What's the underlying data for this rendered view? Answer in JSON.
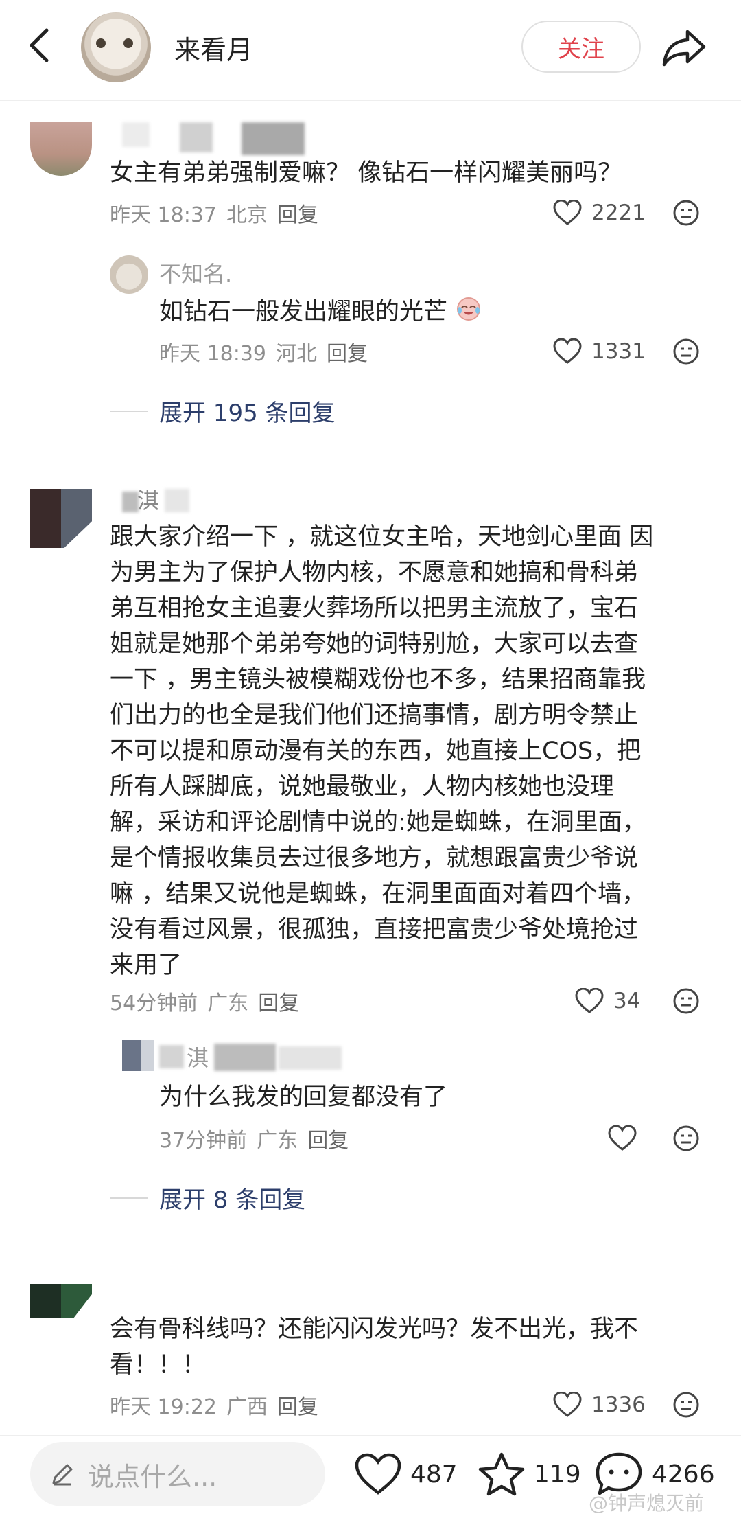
{
  "header": {
    "user_name": "来看月",
    "follow_label": "关注",
    "back_icon": "chevron-left-icon",
    "share_icon": "share-icon"
  },
  "comments": [
    {
      "text": "女主有弟弟强制爱嘛？ 像钻石一样闪耀美丽吗？",
      "time": "昨天 18:37",
      "location": "北京",
      "reply_label": "回复",
      "likes": "2221",
      "reply": {
        "user": "不知名.",
        "text": "如钻石一般发出耀眼的光芒",
        "emoji": "crying-laughing-emoji",
        "time": "昨天 18:39",
        "location": "河北",
        "reply_label": "回复",
        "likes": "1331"
      },
      "expand_label": "展开 195 条回复"
    },
    {
      "user": "淇",
      "text_lines": [
        "跟大家介绍一下 ，就这位女主哈，天地剑心里面 因",
        "为男主为了保护人物内核，不愿意和她搞和骨科弟",
        "弟互相抢女主追妻火葬场所以把男主流放了，宝石",
        "姐就是她那个弟弟夸她的词特别尬，大家可以去查",
        "一下 ，男主镜头被模糊戏份也不多，结果招商靠我",
        "们出力的也全是我们他们还搞事情，剧方明令禁止",
        "不可以提和原动漫有关的东西，她直接上COS，把",
        "所有人踩脚底，说她最敬业，人物内核她也没理",
        "解，采访和评论剧情中说的:她是蜘蛛，在洞里面，",
        "是个情报收集员去过很多地方，就想跟富贵少爷说",
        "嘛 ，结果又说他是蜘蛛，在洞里面面对着四个墙，",
        "没有看过风景，很孤独，直接把富贵少爷处境抢过",
        "来用了"
      ],
      "time": "54分钟前",
      "location": "广东",
      "reply_label": "回复",
      "likes": "34",
      "reply": {
        "user": "淇",
        "text": "为什么我发的回复都没有了",
        "time": "37分钟前",
        "location": "广东",
        "reply_label": "回复",
        "likes": ""
      },
      "expand_label": "展开 8 条回复"
    },
    {
      "text_lines": [
        "会有骨科线吗？还能闪闪发光吗？发不出光，我不",
        "看！！！"
      ],
      "time": "昨天 19:22",
      "location": "广西",
      "reply_label": "回复",
      "likes": "1336"
    }
  ],
  "bottom_bar": {
    "input_placeholder": "说点什么...",
    "like_count": "487",
    "star_count": "119",
    "comment_count": "4266"
  },
  "watermark": "@钟声熄灭前"
}
